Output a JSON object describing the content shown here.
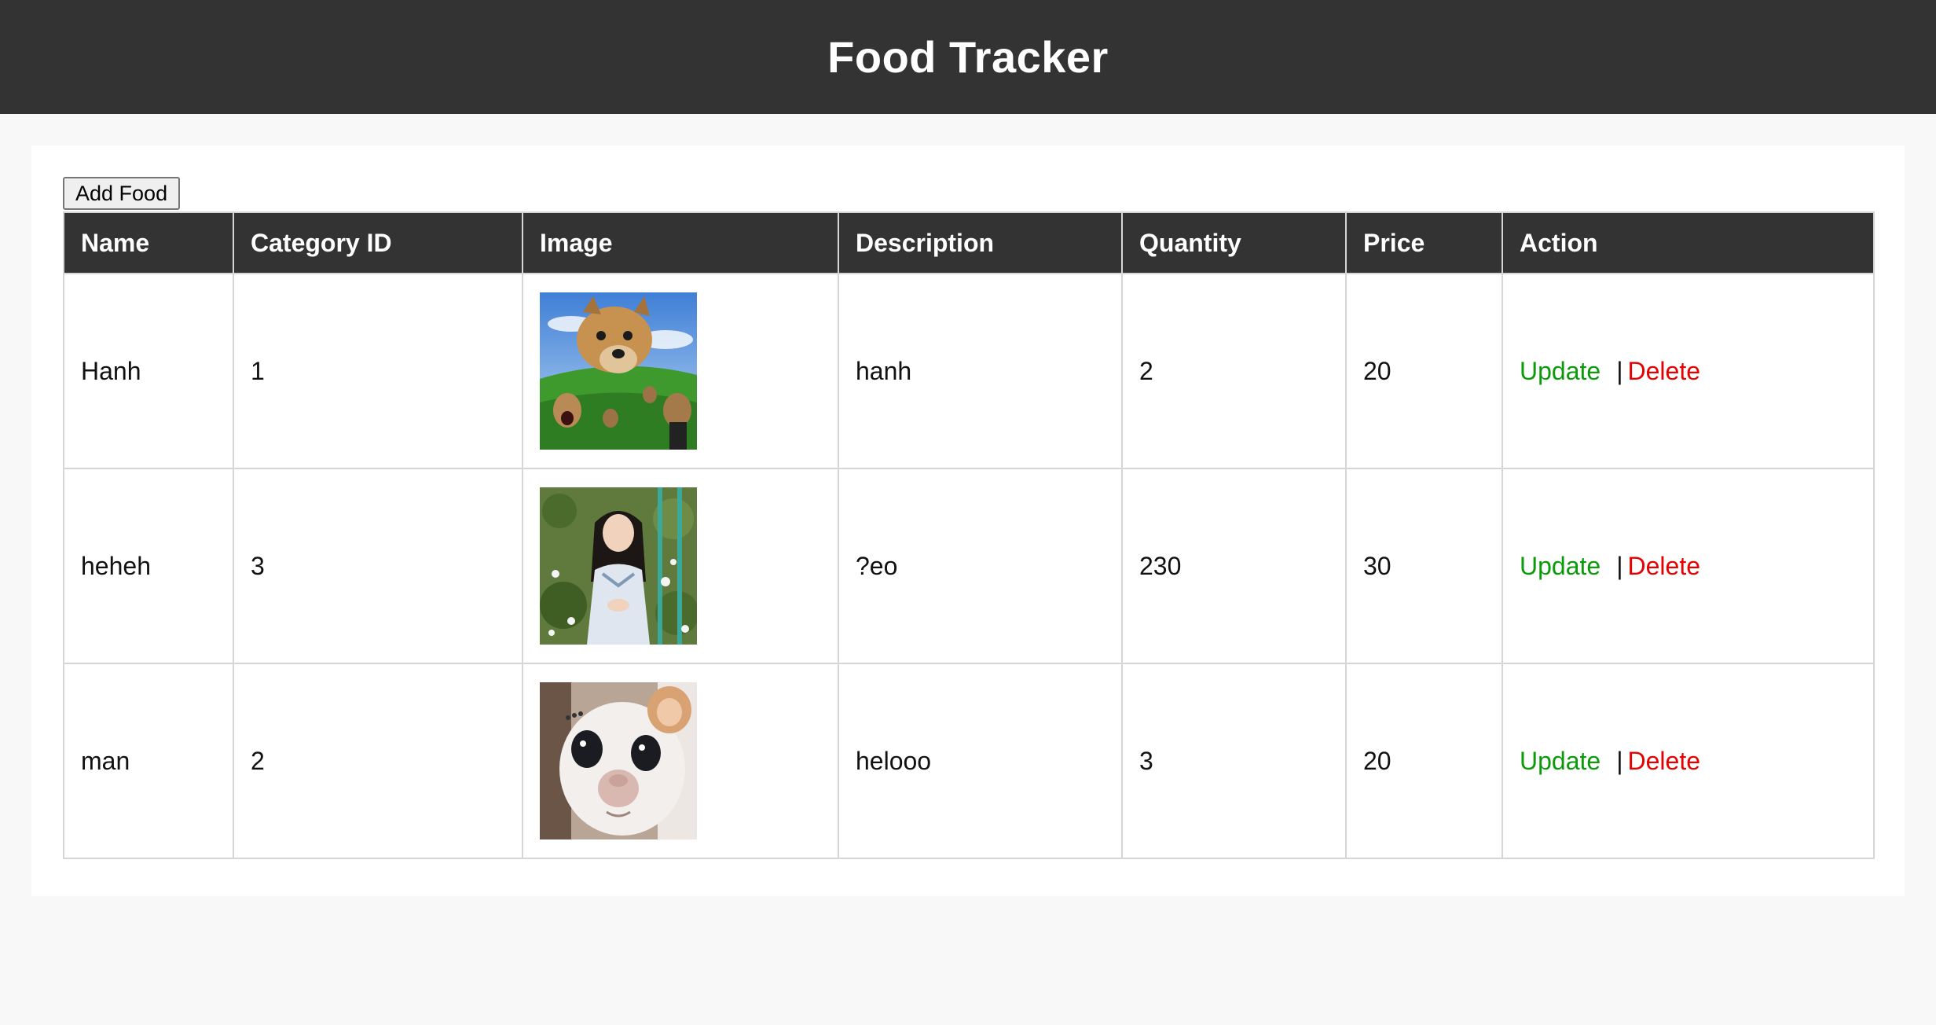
{
  "header": {
    "title": "Food Tracker"
  },
  "toolbar": {
    "add_label": "Add Food"
  },
  "table": {
    "columns": [
      "Name",
      "Category ID",
      "Image",
      "Description",
      "Quantity",
      "Price",
      "Action"
    ],
    "rows": [
      {
        "name": "Hanh",
        "category_id": "1",
        "image": "dog-meme-image",
        "description": "hanh",
        "quantity": "2",
        "price": "20"
      },
      {
        "name": "heheh",
        "category_id": "3",
        "image": "girl-portrait-image",
        "description": "?eo",
        "quantity": "230",
        "price": "30"
      },
      {
        "name": "man",
        "category_id": "2",
        "image": "rat-meme-image",
        "description": "helooo",
        "quantity": "3",
        "price": "20"
      }
    ],
    "actions": {
      "update_label": "Update",
      "separator": "|",
      "delete_label": "Delete"
    }
  },
  "colors": {
    "header_bg": "#333333",
    "update": "#0a9a0a",
    "delete": "#e60000"
  }
}
